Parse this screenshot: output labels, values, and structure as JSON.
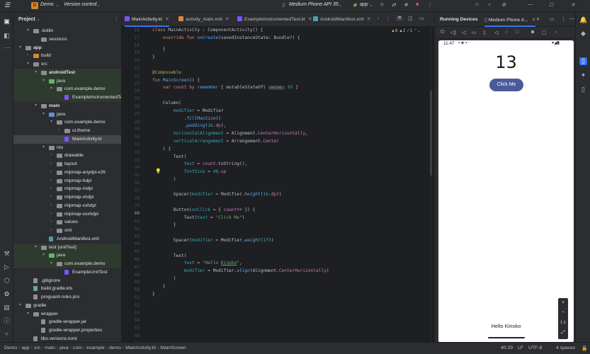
{
  "titlebar": {
    "project_badge": "D",
    "project": "Demo",
    "vcs": "Version control",
    "device": "Medium Phone API 35",
    "run_config": "app"
  },
  "project_panel": {
    "title": "Project"
  },
  "tree": [
    {
      "label": ".kotlin",
      "indent": 1,
      "arrow": "▾",
      "icon": "folder"
    },
    {
      "label": "sessions",
      "indent": 2,
      "arrow": "",
      "icon": "folder"
    },
    {
      "label": "app",
      "indent": 0,
      "arrow": "▾",
      "icon": "module",
      "bold": true
    },
    {
      "label": "build",
      "indent": 1,
      "arrow": "›",
      "icon": "folder-orange"
    },
    {
      "label": "src",
      "indent": 1,
      "arrow": "▾",
      "icon": "folder"
    },
    {
      "label": "androidTest",
      "indent": 2,
      "arrow": "▾",
      "icon": "folder",
      "bold": true,
      "green": true
    },
    {
      "label": "java",
      "indent": 3,
      "arrow": "▾",
      "icon": "folder-green",
      "green": true
    },
    {
      "label": "com.example.demo",
      "indent": 4,
      "arrow": "▾",
      "icon": "folder",
      "green": true
    },
    {
      "label": "ExampleInstrumentedTest",
      "indent": 5,
      "arrow": "",
      "icon": "kotlin",
      "green": true
    },
    {
      "label": "main",
      "indent": 2,
      "arrow": "▾",
      "icon": "folder",
      "bold": true
    },
    {
      "label": "java",
      "indent": 3,
      "arrow": "▾",
      "icon": "folder-blue"
    },
    {
      "label": "com.example.demo",
      "indent": 4,
      "arrow": "▾",
      "icon": "folder"
    },
    {
      "label": "ui.theme",
      "indent": 5,
      "arrow": "›",
      "icon": "folder"
    },
    {
      "label": "MainActivity.kt",
      "indent": 5,
      "arrow": "",
      "icon": "kotlin",
      "selected": true
    },
    {
      "label": "res",
      "indent": 3,
      "arrow": "▾",
      "icon": "folder"
    },
    {
      "label": "drawable",
      "indent": 4,
      "arrow": "›",
      "icon": "folder"
    },
    {
      "label": "layout",
      "indent": 4,
      "arrow": "›",
      "icon": "folder"
    },
    {
      "label": "mipmap-anydpi-v26",
      "indent": 4,
      "arrow": "›",
      "icon": "folder"
    },
    {
      "label": "mipmap-hdpi",
      "indent": 4,
      "arrow": "›",
      "icon": "folder"
    },
    {
      "label": "mipmap-mdpi",
      "indent": 4,
      "arrow": "›",
      "icon": "folder"
    },
    {
      "label": "mipmap-xhdpi",
      "indent": 4,
      "arrow": "›",
      "icon": "folder"
    },
    {
      "label": "mipmap-xxhdpi",
      "indent": 4,
      "arrow": "›",
      "icon": "folder"
    },
    {
      "label": "mipmap-xxxhdpi",
      "indent": 4,
      "arrow": "›",
      "icon": "folder"
    },
    {
      "label": "values",
      "indent": 4,
      "arrow": "›",
      "icon": "folder"
    },
    {
      "label": "xml",
      "indent": 4,
      "arrow": "›",
      "icon": "folder"
    },
    {
      "label": "AndroidManifest.xml",
      "indent": 3,
      "arrow": "",
      "icon": "manifest"
    },
    {
      "label": "test [unitTest]",
      "indent": 2,
      "arrow": "▾",
      "icon": "folder",
      "green": true
    },
    {
      "label": "java",
      "indent": 3,
      "arrow": "▾",
      "icon": "folder-green",
      "green": true
    },
    {
      "label": "com.example.demo",
      "indent": 4,
      "arrow": "▾",
      "icon": "folder",
      "green": true
    },
    {
      "label": "ExampleUnitTest",
      "indent": 5,
      "arrow": "",
      "icon": "kotlin"
    },
    {
      "label": ".gitignore",
      "indent": 1,
      "arrow": "",
      "icon": "file"
    },
    {
      "label": "build.gradle.kts",
      "indent": 1,
      "arrow": "",
      "icon": "gradle"
    },
    {
      "label": "proguard-rules.pro",
      "indent": 1,
      "arrow": "",
      "icon": "file"
    },
    {
      "label": "gradle",
      "indent": 0,
      "arrow": "▾",
      "icon": "folder"
    },
    {
      "label": "wrapper",
      "indent": 1,
      "arrow": "▾",
      "icon": "folder"
    },
    {
      "label": "gradle-wrapper.jar",
      "indent": 2,
      "arrow": "",
      "icon": "file"
    },
    {
      "label": "gradle-wrapper.properties",
      "indent": 2,
      "arrow": "",
      "icon": "file"
    },
    {
      "label": "libs.versions.toml",
      "indent": 1,
      "arrow": "",
      "icon": "file"
    }
  ],
  "tabs": [
    {
      "label": "MainActivity.kt",
      "active": true,
      "icon": "kotlin"
    },
    {
      "label": "activity_main.xml",
      "active": false,
      "icon": "xml"
    },
    {
      "label": "ExampleInstrumentedTest.kt",
      "active": false,
      "icon": "kotlin"
    },
    {
      "label": "AndroidManifest.xml",
      "active": false,
      "icon": "manifest"
    }
  ],
  "editor": {
    "line_numbers": [
      "16",
      "17",
      "18",
      "19",
      "20",
      "21",
      "22",
      "23",
      "24",
      "25",
      "26",
      "27",
      "28",
      "29",
      "30",
      "31",
      "32",
      "33",
      "34",
      "35",
      "36",
      "37",
      "38",
      "39",
      "40",
      "41",
      "42",
      "43",
      "44",
      "45",
      "46",
      "47",
      "48",
      "49",
      "50",
      "51",
      "52",
      "53",
      "54",
      "55",
      "56",
      "57"
    ],
    "current_line": "40",
    "problems": {
      "warnings": "8",
      "weak": "2",
      "typos": "1"
    }
  },
  "devices": {
    "panel_title": "Running Devices",
    "device_tab": "Medium Phone A..."
  },
  "phone": {
    "time": "11:47",
    "count": "13",
    "button": "Click Me",
    "hello": "Hello Kinoko",
    "zoom": "1:1"
  },
  "statusbar": {
    "crumbs": [
      "Demo",
      "app",
      "src",
      "main",
      "java",
      "com",
      "example",
      "demo",
      "MainActivity.kt",
      "MainScreen"
    ],
    "position": "40:29",
    "line_sep": "LF",
    "encoding": "UTF-8",
    "indent": "4 spaces"
  }
}
